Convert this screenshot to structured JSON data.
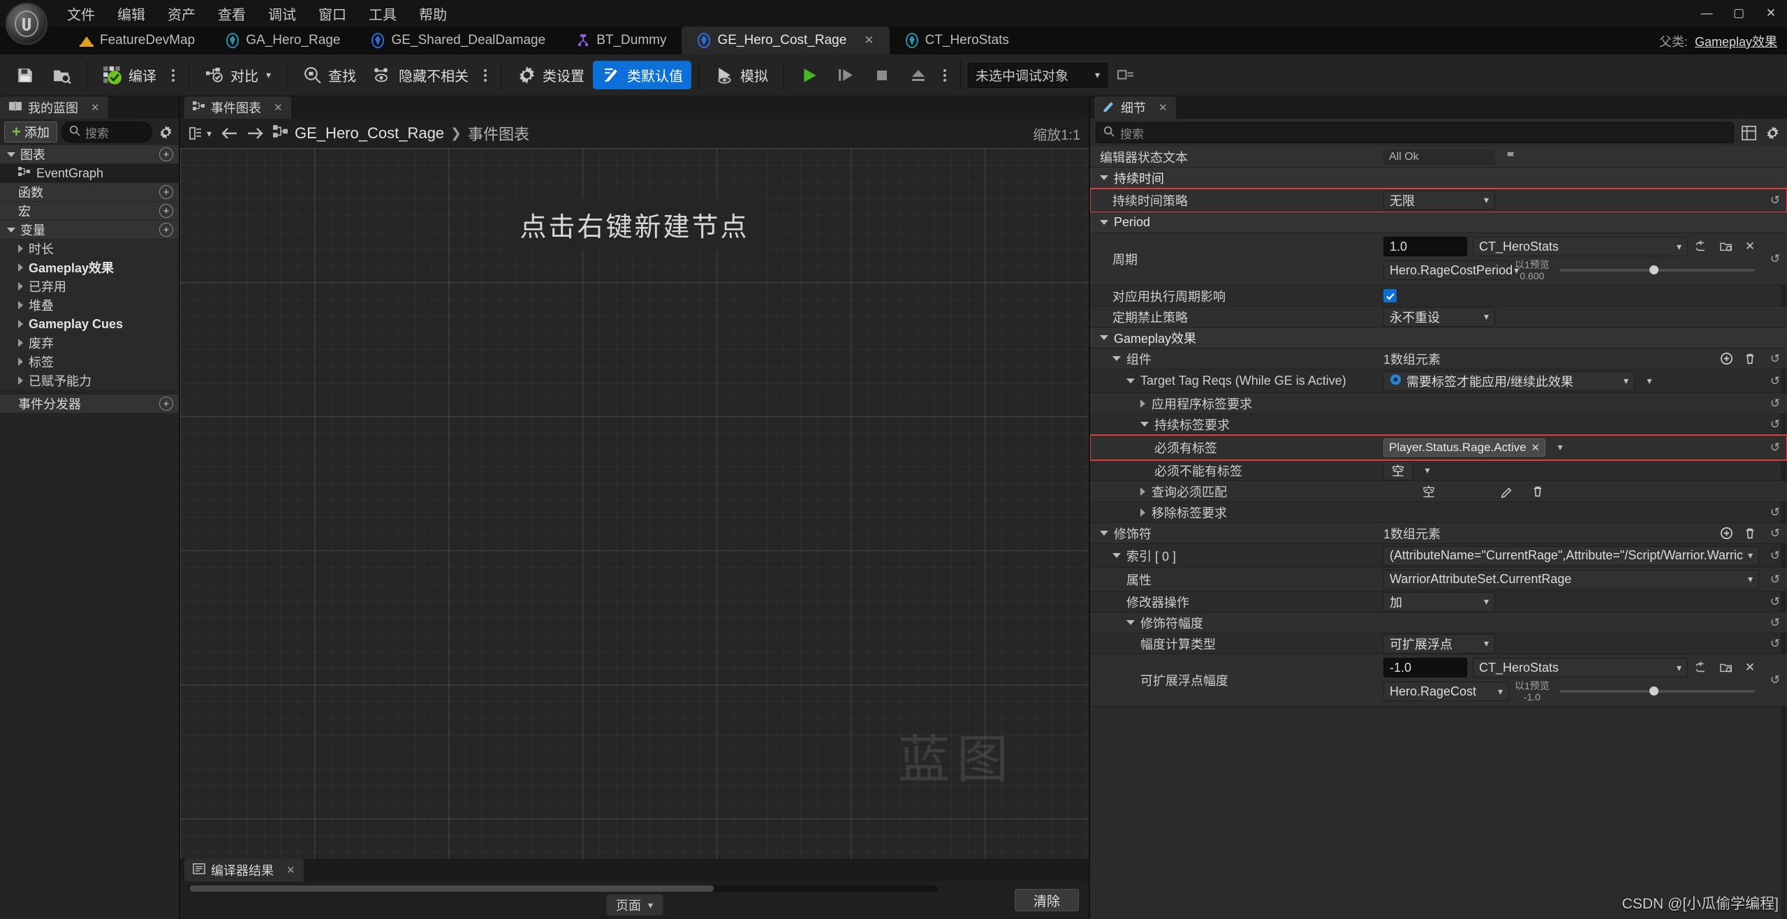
{
  "menu": {
    "items": [
      "文件",
      "编辑",
      "资产",
      "查看",
      "调试",
      "窗口",
      "工具",
      "帮助"
    ],
    "window_controls": {
      "minimize": "—",
      "maximize": "▢",
      "close": "✕"
    }
  },
  "tabs": {
    "items": [
      {
        "label": "FeatureDevMap",
        "icon": "map-icon",
        "active": false
      },
      {
        "label": "GA_Hero_Rage",
        "icon": "blueprint-teal-icon",
        "active": false
      },
      {
        "label": "GE_Shared_DealDamage",
        "icon": "blueprint-blue-icon",
        "active": false
      },
      {
        "label": "BT_Dummy",
        "icon": "behavior-tree-icon",
        "active": false
      },
      {
        "label": "GE_Hero_Cost_Rage",
        "icon": "blueprint-blue-icon",
        "active": true,
        "close": "✕"
      },
      {
        "label": "CT_HeroStats",
        "icon": "curve-table-icon",
        "active": false
      }
    ],
    "parent_label": "父类:",
    "parent_value": "Gameplay效果"
  },
  "toolbar": {
    "save_tooltip": "保存",
    "browse_tooltip": "浏览",
    "compile_label": "编译",
    "diff_label": "对比",
    "find_label": "查找",
    "hide_unrelated_label": "隐藏不相关",
    "class_settings_label": "类设置",
    "class_defaults_label": "类默认值",
    "simulate_label": "模拟",
    "play_label": "播放",
    "step_label": "单步",
    "stop_label": "停止",
    "eject_label": "弹出",
    "debug_target_value": "未选中调试对象"
  },
  "my_blueprint": {
    "tab_title": "我的蓝图",
    "tab_close": "✕",
    "add_label": "添加",
    "search_placeholder": "搜索",
    "settings_icon": "gear-icon",
    "sections": [
      {
        "label": "图表",
        "expanded": true,
        "has_add": true,
        "items": [
          {
            "label": "EventGraph",
            "icon": "event-graph-icon",
            "selected": true
          }
        ]
      },
      {
        "label": "函数",
        "expanded": false,
        "has_add": true,
        "items": []
      },
      {
        "label": "宏",
        "expanded": false,
        "has_add": true,
        "items": []
      },
      {
        "label": "变量",
        "expanded": true,
        "has_add": true,
        "items": []
      }
    ],
    "variables": [
      {
        "label": "时长",
        "bold": false
      },
      {
        "label": "Gameplay效果",
        "bold": true
      },
      {
        "label": "已弃用",
        "bold": false
      },
      {
        "label": "堆叠",
        "bold": false
      },
      {
        "label": "Gameplay Cues",
        "bold": true
      },
      {
        "label": "废弃",
        "bold": false
      },
      {
        "label": "标签",
        "bold": false
      },
      {
        "label": "已赋予能力",
        "bold": false
      }
    ],
    "event_dispatcher": {
      "label": "事件分发器",
      "has_add": true
    }
  },
  "graph": {
    "tab_title": "事件图表",
    "tab_close": "✕",
    "breadcrumb_root": "GE_Hero_Cost_Rage",
    "breadcrumb_sep": "❯",
    "breadcrumb_current": "事件图表",
    "zoom_label": "缩放1:1",
    "canvas_hint": "点击右键新建节点",
    "watermark": "蓝图",
    "back_icon": "arrow-left-icon",
    "forward_icon": "arrow-right-icon"
  },
  "compiler_results": {
    "tab_title": "编译器结果",
    "tab_close": "✕",
    "page_label": "页面",
    "clear_label": "清除"
  },
  "details": {
    "tab_title": "细节",
    "tab_close": "✕",
    "search_placeholder": "搜索",
    "grid_icon": "grid-icon",
    "settings_icon": "gear-icon",
    "status_row": {
      "label": "编辑器状态文本",
      "value": "All Ok",
      "flag_icon": "flag-icon"
    },
    "sections": [
      {
        "id": "duration",
        "label": "持续时间",
        "expanded": true,
        "rows": [
          {
            "label": "持续时间策略",
            "type": "combo",
            "value": "无限",
            "highlight": true,
            "reset": "↺"
          }
        ]
      },
      {
        "id": "period",
        "label": "Period",
        "expanded": true,
        "rows": [
          {
            "label": "周期",
            "type": "scalable-float",
            "value": "1.0",
            "curve_table": "CT_HeroStats",
            "curve_row": "Hero.RageCostPeriod",
            "preview_label": "以1预览",
            "preview_value": "0.600",
            "icons": [
              "browse-icon",
              "use-asset-icon",
              "clear-icon"
            ],
            "reset": "↺"
          },
          {
            "label": "对应用执行周期影响",
            "type": "checkbox",
            "checked": true
          },
          {
            "label": "定期禁止策略",
            "type": "combo",
            "value": "永不重设"
          }
        ]
      },
      {
        "id": "gameplay_effect",
        "label": "Gameplay效果",
        "expanded": true,
        "rows": [
          {
            "label": "组件",
            "type": "array-header",
            "value": "1数组元素",
            "add_icon": "plus-icon",
            "delete_icon": "trash-icon",
            "reset": "↺",
            "highlight": true
          },
          {
            "label": "Target Tag Reqs (While GE is Active)",
            "type": "combo-asset",
            "value": "需要标签才能应用/继续此效果",
            "reset": "↺"
          },
          {
            "label": "应用程序标签要求",
            "type": "group",
            "expanded": false,
            "reset": "↺"
          },
          {
            "label": "持续标签要求",
            "type": "group",
            "expanded": true,
            "reset": "↺"
          },
          {
            "label": "必须有标签",
            "type": "tag",
            "value": "Player.Status.Rage.Active",
            "highlight": true,
            "reset": "↺"
          },
          {
            "label": "必须不能有标签",
            "type": "combo-empty",
            "value": "空"
          },
          {
            "label": "查询必须匹配",
            "type": "query",
            "value": "空",
            "edit_icon": "pencil-icon",
            "delete_icon": "trash-icon"
          },
          {
            "label": "移除标签要求",
            "type": "group",
            "expanded": false,
            "reset": "↺"
          }
        ]
      },
      {
        "id": "modifiers",
        "label": "修饰符",
        "expanded": true,
        "rows": [
          {
            "label": "修饰符",
            "type": "array-header",
            "value": "1数组元素",
            "add_icon": "plus-icon",
            "delete_icon": "trash-icon",
            "reset": "↺"
          },
          {
            "label": "索引 [ 0 ]",
            "type": "struct",
            "value": "(AttributeName=\"CurrentRage\",Attribute=\"/Script/Warrior.Warric",
            "reset": "↺",
            "highlight": true
          },
          {
            "label": "属性",
            "type": "combo",
            "value": "WarriorAttributeSet.CurrentRage",
            "reset": "↺"
          },
          {
            "label": "修改器操作",
            "type": "combo",
            "value": "加",
            "reset": "↺"
          },
          {
            "label": "修饰符幅度",
            "type": "group",
            "expanded": true,
            "reset": "↺"
          },
          {
            "label": "幅度计算类型",
            "type": "combo",
            "value": "可扩展浮点",
            "reset": "↺"
          },
          {
            "label": "可扩展浮点幅度",
            "type": "scalable-float",
            "value": "-1.0",
            "curve_table": "CT_HeroStats",
            "curve_row": "Hero.RageCost",
            "preview_label": "以1预览",
            "preview_value": "-1.0",
            "icons": [
              "browse-icon",
              "use-asset-icon",
              "clear-icon"
            ],
            "reset": "↺"
          }
        ]
      }
    ]
  },
  "watermark_text": "CSDN @[小瓜偷学编程]",
  "colors": {
    "accent_blue": "#0c70d8",
    "highlight_red": "#e03c3c",
    "compile_green": "#7ec24a",
    "panel_bg": "#2b2b2b",
    "toolbar_bg": "#242424",
    "canvas_bg": "#262626"
  }
}
